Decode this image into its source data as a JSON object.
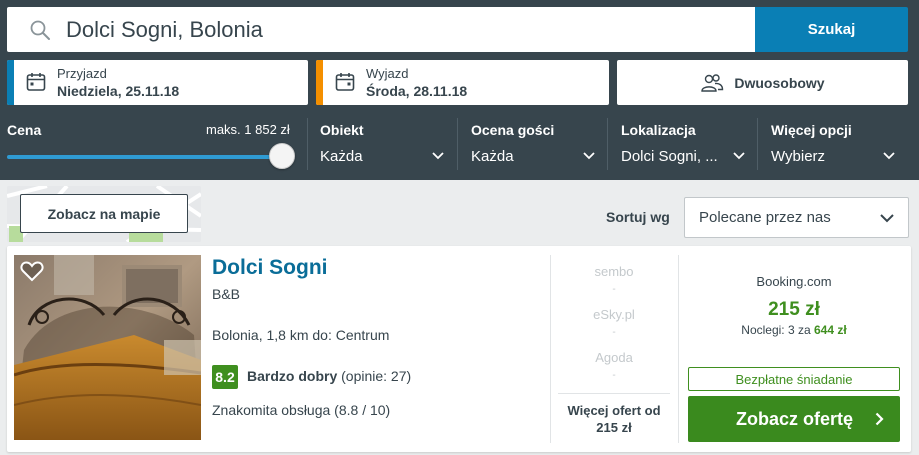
{
  "search": {
    "query": "Dolci Sogni, Bolonia",
    "button_label": "Szukaj"
  },
  "checkin": {
    "label": "Przyjazd",
    "value": "Niedziela, 25.11.18",
    "accent_color": "#0a7fb5"
  },
  "checkout": {
    "label": "Wyjazd",
    "value": "Środa, 28.11.18",
    "accent_color": "#f48f00"
  },
  "room": {
    "label": "Dwuosobowy"
  },
  "filters": {
    "price": {
      "label": "Cena",
      "max_label": "maks. 1 852 zł",
      "slider_fraction": 1.0
    },
    "property": {
      "label": "Obiekt",
      "value": "Każda"
    },
    "guest_rating": {
      "label": "Ocena gości",
      "value": "Każda"
    },
    "location": {
      "label": "Lokalizacja",
      "value": "Dolci Sogni, ..."
    },
    "more": {
      "label": "Więcej opcji",
      "value": "Wybierz"
    }
  },
  "map": {
    "button_label": "Zobacz na mapie"
  },
  "sort": {
    "label": "Sortuj wg",
    "value": "Polecane przez nas"
  },
  "hotel": {
    "name": "Dolci Sogni",
    "type": "B&B",
    "location": "Bolonia, 1,8 km do: Centrum",
    "score": "8.2",
    "rating_word": "Bardzo dobry",
    "reviews": "(opinie: 27)",
    "review_highlight": "Znakomita obsługa (8.8 / 10)",
    "score_color": "#3f8f1f"
  },
  "alt_offers": [
    {
      "name": "sembo",
      "price": "-"
    },
    {
      "name": "eSky.pl",
      "price": "-"
    },
    {
      "name": "Agoda",
      "price": "-"
    }
  ],
  "more_offers": {
    "line1": "Więcej ofert od",
    "line2": "215 zł"
  },
  "best_offer": {
    "provider": "Booking.com",
    "price": "215 zł",
    "nights_prefix": "Noclegi: 3 za",
    "nights_total": "644 zł",
    "badge": "Bezpłatne śniadanie",
    "cta_label": "Zobacz ofertę",
    "cta_color": "#3a8a1e"
  }
}
